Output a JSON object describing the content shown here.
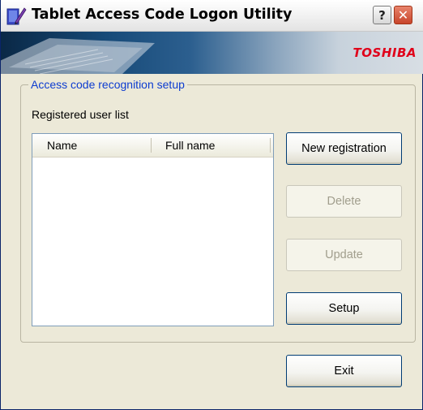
{
  "window": {
    "title": "Tablet Access Code Logon Utility",
    "icon": "pen-tablet-icon",
    "help_label": "?",
    "close_label": "✕"
  },
  "banner": {
    "brand": "TOSHIBA",
    "brand_color": "#e0001a"
  },
  "group": {
    "title": "Access code recognition setup",
    "list_label": "Registered user list",
    "columns": [
      "Name",
      "Full name"
    ],
    "rows": []
  },
  "buttons": {
    "new_registration": "New registration",
    "delete": "Delete",
    "update": "Update",
    "setup": "Setup",
    "exit": "Exit"
  },
  "states": {
    "delete_enabled": false,
    "update_enabled": false
  }
}
